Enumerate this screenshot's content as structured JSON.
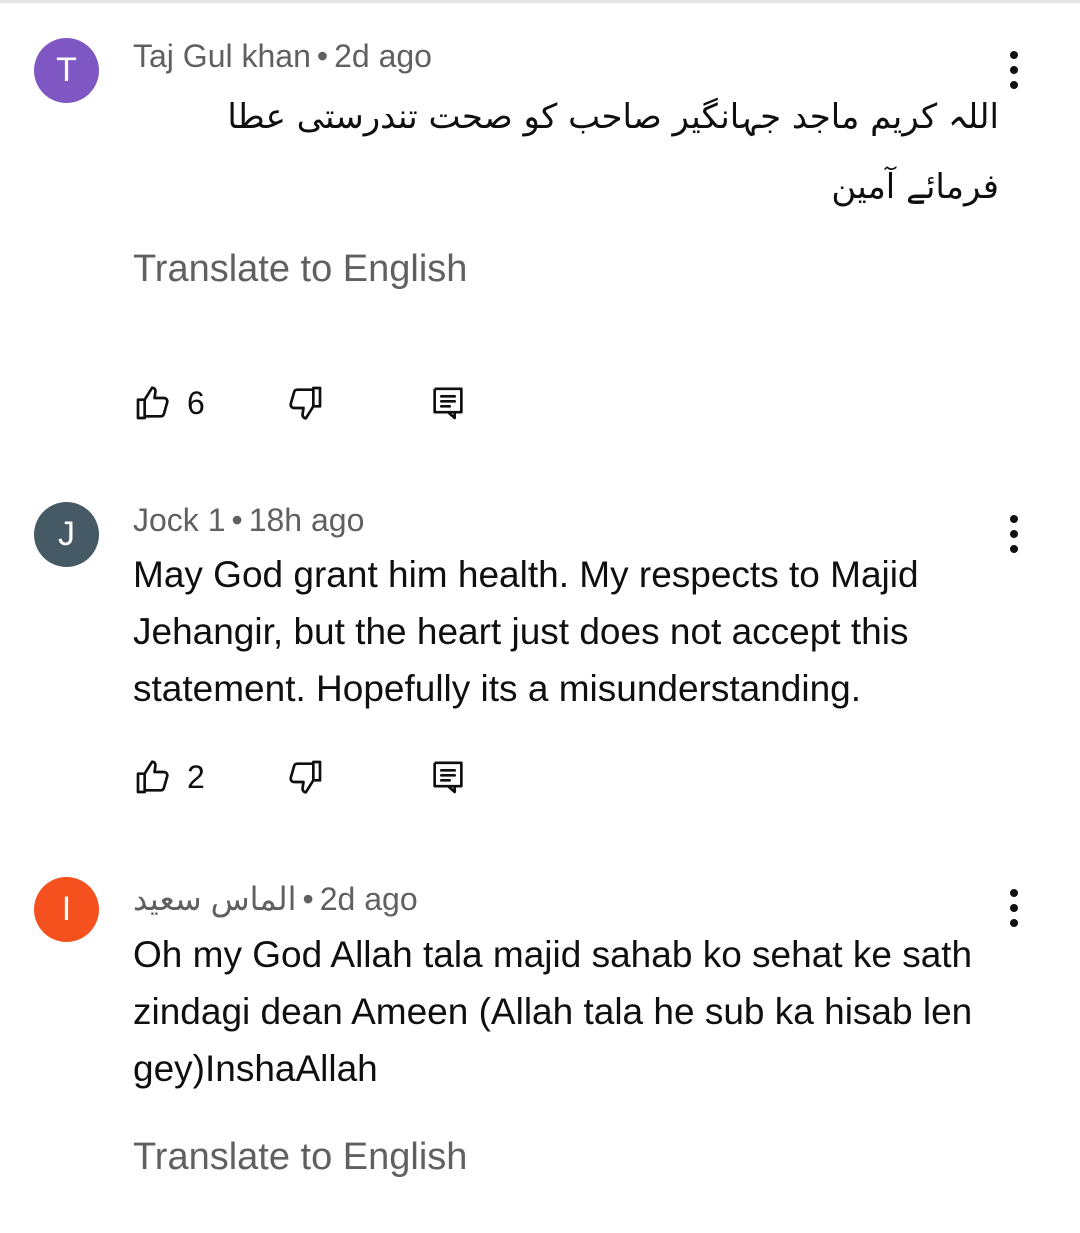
{
  "comments": [
    {
      "avatar_letter": "T",
      "avatar_color": "#7e57c2",
      "author": "Taj Gul khan",
      "time": "2d ago",
      "text": "اللہ کریم ماجد جہانگیر صاحب کو صحت تندرستی عطا فرمائے آمین",
      "translate_label": "Translate to English",
      "likes": "6"
    },
    {
      "avatar_letter": "J",
      "avatar_color": "#455a64",
      "author": "Jock 1",
      "time": "18h ago",
      "text": "May God grant him health. My respects to Majid Jehangir, but the heart just does not accept this statement. Hopefully its a misunderstanding.",
      "likes": "2"
    },
    {
      "avatar_letter": "I",
      "avatar_color": "#f4511e",
      "author": "الماس سعید",
      "time": "2d ago",
      "text": "Oh my God Allah tala majid sahab ko sehat ke sath zindagi dean Ameen  (Allah tala he sub ka hisab len gey)InshaAllah",
      "translate_label": "Translate to English"
    }
  ],
  "separator": "•",
  "icons": {
    "like": "thumbs-up-icon",
    "dislike": "thumbs-down-icon",
    "reply": "reply-icon",
    "more": "more-vert-icon"
  }
}
